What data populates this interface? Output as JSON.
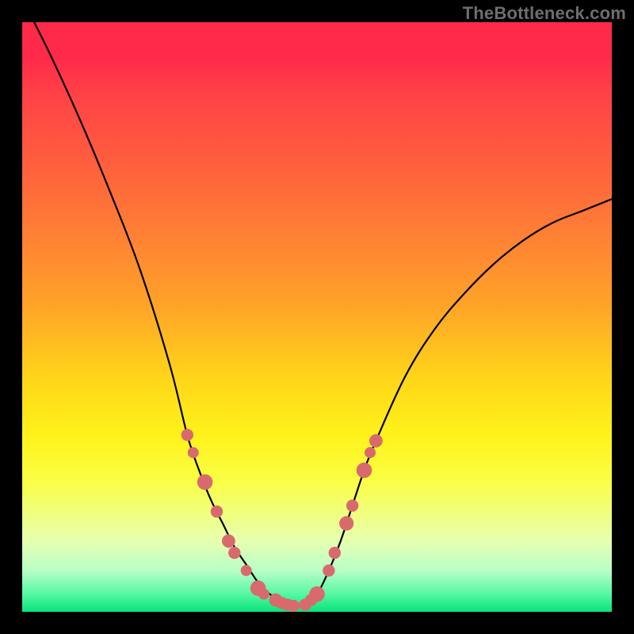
{
  "watermark": "TheBottleneck.com",
  "colors": {
    "marker": "#d86a6e",
    "curve": "#000000",
    "frame": "#000000",
    "gradient_top": "#ff2a4a",
    "gradient_bottom": "#08e47a"
  },
  "chart_data": {
    "type": "line",
    "title": "",
    "xlabel": "",
    "ylabel": "",
    "xlim": [
      0,
      100
    ],
    "ylim": [
      0,
      100
    ],
    "x": [
      0,
      5,
      10,
      15,
      20,
      25,
      28,
      30,
      32,
      34,
      36,
      38,
      40,
      42,
      44,
      45,
      46,
      47,
      48,
      50,
      52,
      54,
      56,
      58,
      60,
      65,
      70,
      75,
      80,
      85,
      90,
      95,
      100
    ],
    "y": [
      104,
      94,
      83,
      71,
      58,
      42,
      30,
      24,
      19,
      15,
      11,
      8,
      5,
      3,
      2,
      1.5,
      1,
      1,
      1.5,
      3,
      7,
      12,
      18,
      24,
      29,
      40,
      48,
      54,
      59,
      63,
      66,
      68,
      70
    ],
    "series": [
      {
        "name": "bottleneck-curve",
        "type": "line",
        "uses": "x & y above"
      },
      {
        "name": "highlighted-points",
        "type": "scatter",
        "points": [
          {
            "x": 28,
            "y": 30,
            "r": 1.1
          },
          {
            "x": 29,
            "y": 27,
            "r": 1.0
          },
          {
            "x": 31,
            "y": 22,
            "r": 1.4
          },
          {
            "x": 33,
            "y": 17,
            "r": 1.1
          },
          {
            "x": 35,
            "y": 12,
            "r": 1.2
          },
          {
            "x": 36,
            "y": 10,
            "r": 1.1
          },
          {
            "x": 38,
            "y": 7,
            "r": 1.0
          },
          {
            "x": 40,
            "y": 4,
            "r": 1.4
          },
          {
            "x": 41,
            "y": 3,
            "r": 1.0
          },
          {
            "x": 43,
            "y": 2,
            "r": 1.2
          },
          {
            "x": 44,
            "y": 1.5,
            "r": 1.1
          },
          {
            "x": 45,
            "y": 1.2,
            "r": 1.1
          },
          {
            "x": 46,
            "y": 1,
            "r": 1.1
          },
          {
            "x": 48,
            "y": 1.2,
            "r": 1.1
          },
          {
            "x": 49,
            "y": 2,
            "r": 1.1
          },
          {
            "x": 50,
            "y": 3,
            "r": 1.4
          },
          {
            "x": 52,
            "y": 7,
            "r": 1.1
          },
          {
            "x": 53,
            "y": 10,
            "r": 1.1
          },
          {
            "x": 55,
            "y": 15,
            "r": 1.3
          },
          {
            "x": 56,
            "y": 18,
            "r": 1.1
          },
          {
            "x": 58,
            "y": 24,
            "r": 1.4
          },
          {
            "x": 59,
            "y": 27,
            "r": 1.0
          },
          {
            "x": 60,
            "y": 29,
            "r": 1.2
          }
        ]
      }
    ]
  }
}
